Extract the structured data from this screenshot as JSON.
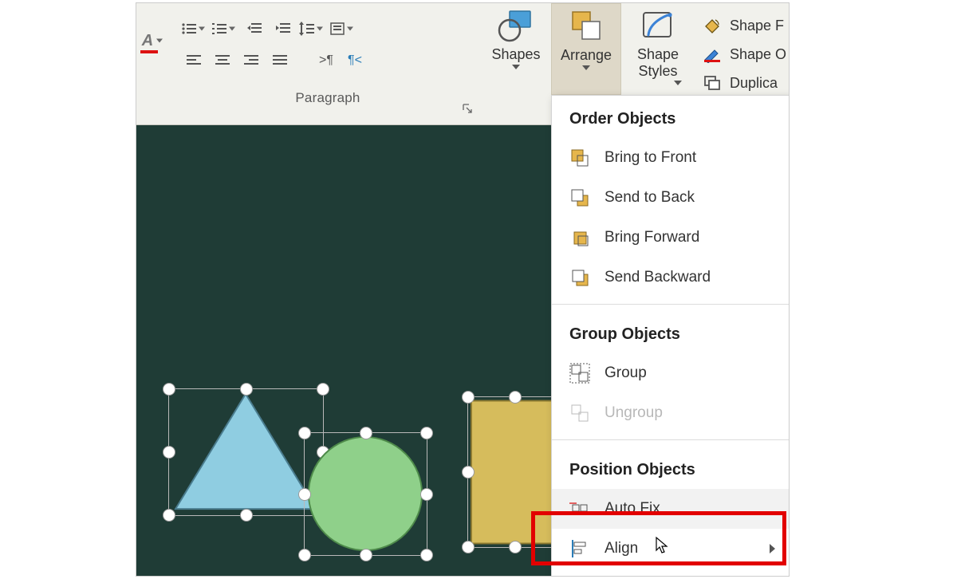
{
  "ribbon": {
    "paragraph_group_label": "Paragraph",
    "shapes_label": "Shapes",
    "arrange_label": "Arrange",
    "shape_styles_label": "Shape Styles",
    "right_items": {
      "shape_fill": "Shape F",
      "shape_outline": "Shape O",
      "duplicate": "Duplica"
    }
  },
  "menu": {
    "order_header": "Order Objects",
    "bring_to_front": "Bring to Front",
    "send_to_back": "Send to Back",
    "bring_forward": "Bring Forward",
    "send_backward": "Send Backward",
    "group_header": "Group Objects",
    "group": "Group",
    "ungroup": "Ungroup",
    "position_header": "Position Objects",
    "auto_fix": "Auto Fix",
    "align": "Align"
  },
  "shape_colors": {
    "triangle": "#8fcde1",
    "circle": "#8fd08a",
    "rect": "#d6bc5c"
  }
}
